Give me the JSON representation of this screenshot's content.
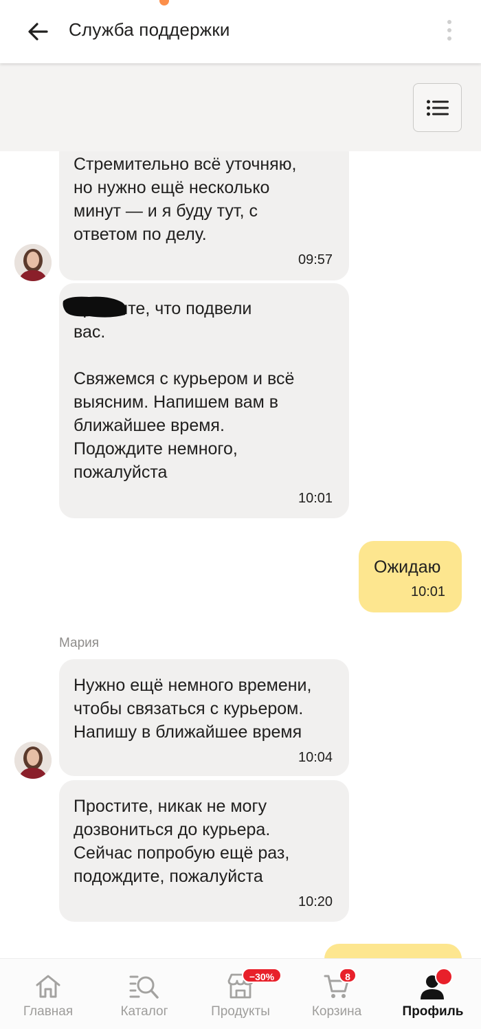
{
  "header": {
    "title": "Служба поддержки"
  },
  "chat": {
    "sender_name": "Мария",
    "messages": [
      {
        "text": "Стремительно всё уточняю,\nно нужно ещё несколько\nминут — и я буду тут, с\nответом по делу.",
        "time": "09:57"
      },
      {
        "text": "           простите, что подвели\nвас.\n\nСвяжемся с курьером и всё\nвыясним. Напишем вам в\nближайшее время.\nПодождите немного,\nпожалуйста",
        "time": "10:01"
      },
      {
        "text": "Ожидаю",
        "time": "10:01"
      },
      {
        "text": "Нужно ещё немного времени,\nчтобы связаться с курьером.\nНапишу в ближайшее время",
        "time": "10:04"
      },
      {
        "text": "Простите, никак не могу\nдозвониться до курьера.\nСейчас попробую ещё раз,\nподождите, пожалуйста",
        "time": "10:20"
      }
    ]
  },
  "tabs": [
    {
      "label": "Главная",
      "icon": "home-icon"
    },
    {
      "label": "Каталог",
      "icon": "catalog-search-icon"
    },
    {
      "label": "Продукты",
      "icon": "store-icon",
      "badge": "−30%"
    },
    {
      "label": "Корзина",
      "icon": "cart-icon",
      "badge": "8"
    },
    {
      "label": "Профиль",
      "icon": "profile-icon",
      "active": true
    }
  ],
  "colors": {
    "incoming_bubble": "#f1f0ef",
    "outgoing_bubble": "#fde68f",
    "badge": "#e8202a"
  }
}
